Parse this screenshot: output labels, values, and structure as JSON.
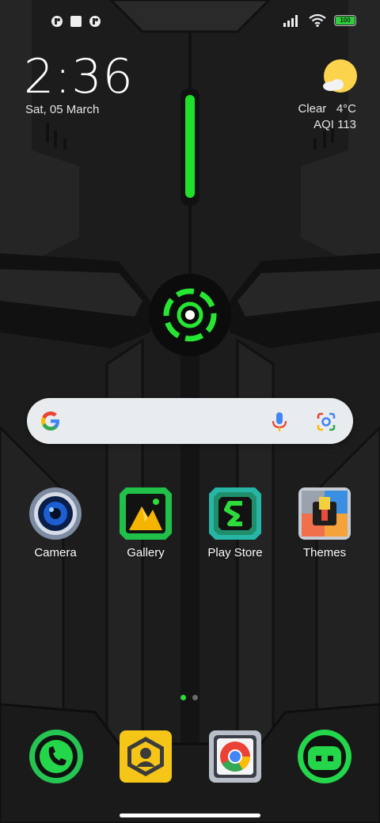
{
  "status_bar": {
    "left_icons": [
      "notification-app-icon",
      "notification-square-icon",
      "notification-app-icon"
    ],
    "right_icons": [
      "signal-icon",
      "wifi-icon",
      "battery-icon"
    ],
    "battery_level": "100"
  },
  "clock": {
    "time": "2:36",
    "date": "Sat, 05 March"
  },
  "weather": {
    "condition": "Clear",
    "temperature": "4°C",
    "aqi": "AQI 113",
    "icon": "partly-cloudy-icon"
  },
  "search": {
    "placeholder": "",
    "icons": [
      "google-g-icon",
      "microphone-icon",
      "google-lens-icon"
    ]
  },
  "apps": [
    {
      "label": "Camera",
      "icon": "camera-icon"
    },
    {
      "label": "Gallery",
      "icon": "gallery-icon"
    },
    {
      "label": "Play Store",
      "icon": "play-store-icon"
    },
    {
      "label": "Themes",
      "icon": "themes-icon"
    }
  ],
  "page_indicator": {
    "pages": 2,
    "current": 1
  },
  "dock": [
    {
      "icon": "phone-icon"
    },
    {
      "icon": "contacts-icon"
    },
    {
      "icon": "chrome-icon"
    },
    {
      "icon": "messages-icon"
    }
  ],
  "colors": {
    "accent": "#2ddc3a",
    "background": "#1b1b1b"
  }
}
